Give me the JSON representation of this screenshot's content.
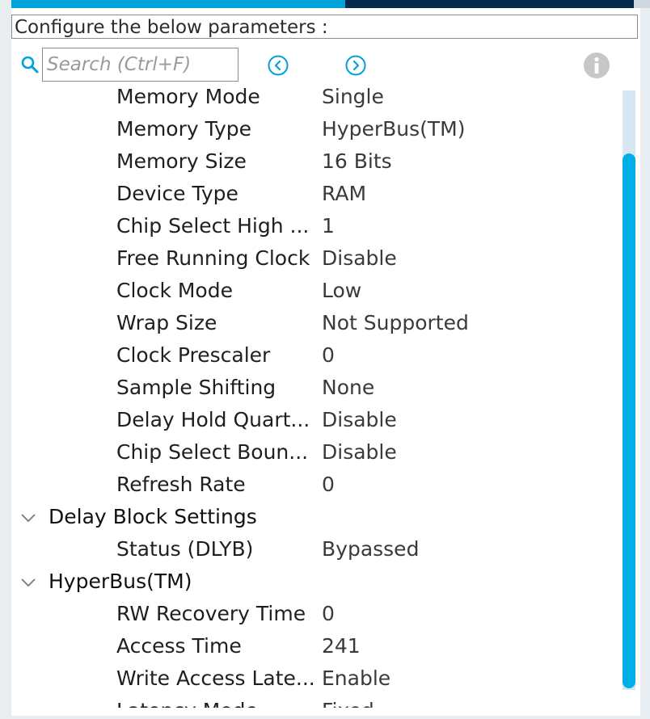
{
  "header": {
    "config_prompt": "Configure the below parameters :"
  },
  "toolbar": {
    "search_placeholder": "Search (Ctrl+F)",
    "icons": {
      "search": "magnifier-icon",
      "prev": "circle-chevron-left-icon",
      "next": "circle-chevron-right-icon",
      "info": "info-icon"
    }
  },
  "params": {
    "memory_settings": [
      {
        "label": "Memory Mode",
        "value": "Single"
      },
      {
        "label": "Memory Type",
        "value": "HyperBus(TM)"
      },
      {
        "label": "Memory Size",
        "value": "16 Bits"
      },
      {
        "label": "Device Type",
        "value": "RAM"
      },
      {
        "label": "Chip Select High ...",
        "value": "1"
      },
      {
        "label": "Free Running Clock",
        "value": "Disable"
      },
      {
        "label": "Clock Mode",
        "value": "Low"
      },
      {
        "label": "Wrap Size",
        "value": "Not Supported"
      },
      {
        "label": "Clock Prescaler",
        "value": "0"
      },
      {
        "label": "Sample Shifting",
        "value": "None"
      },
      {
        "label": "Delay Hold Quart...",
        "value": "Disable"
      },
      {
        "label": "Chip Select Boun...",
        "value": "Disable"
      },
      {
        "label": "Refresh Rate",
        "value": "0"
      }
    ],
    "delay_block": {
      "title": "Delay Block Settings",
      "items": [
        {
          "label": "Status (DLYB)",
          "value": "Bypassed"
        }
      ]
    },
    "hyperbus": {
      "title": "HyperBus(TM)",
      "items": [
        {
          "label": "RW Recovery Time",
          "value": "0"
        },
        {
          "label": "Access Time",
          "value": "241"
        },
        {
          "label": "Write Access Late...",
          "value": "Enable"
        },
        {
          "label": "Latency Mode",
          "value": "Fixed"
        }
      ]
    }
  },
  "colors": {
    "accent": "#00a2d9",
    "dark_tab": "#042b4b",
    "scroll_thumb": "#00aee8",
    "scroll_track": "#d6e6f2"
  }
}
